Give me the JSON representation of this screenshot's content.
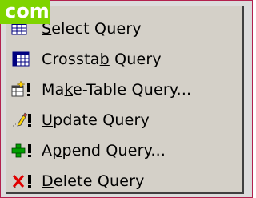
{
  "badge": {
    "text": "com"
  },
  "menu": {
    "items": [
      {
        "pre": "",
        "mnemonic": "S",
        "post": "elect Query",
        "icon": "select-query-icon"
      },
      {
        "pre": "Crossta",
        "mnemonic": "b",
        "post": " Query",
        "icon": "crosstab-query-icon"
      },
      {
        "pre": "Ma",
        "mnemonic": "k",
        "post": "e-Table Query...",
        "icon": "make-table-query-icon"
      },
      {
        "pre": "",
        "mnemonic": "U",
        "post": "pdate Query",
        "icon": "update-query-icon"
      },
      {
        "pre": "A",
        "mnemonic": "p",
        "post": "pend Query...",
        "icon": "append-query-icon"
      },
      {
        "pre": "",
        "mnemonic": "D",
        "post": "elete Query",
        "icon": "delete-query-icon"
      }
    ]
  }
}
